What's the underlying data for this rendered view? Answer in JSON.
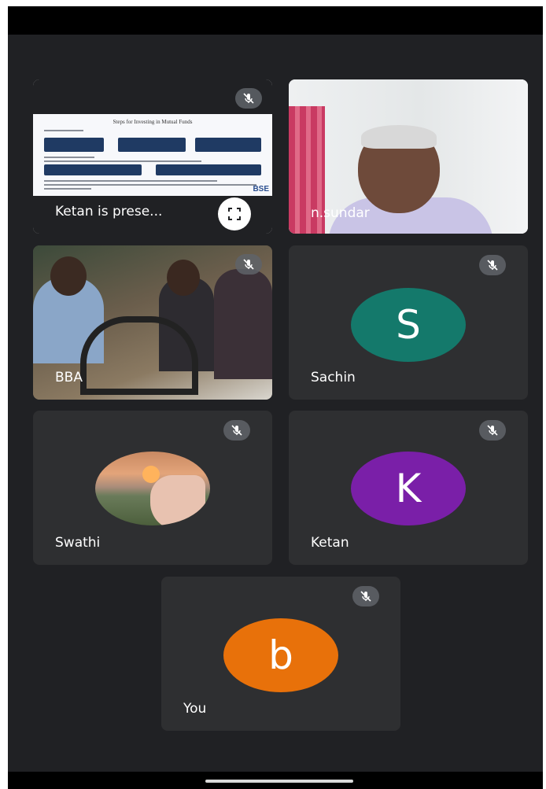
{
  "meeting": {
    "tiles": [
      {
        "name": "Ketan is prese...",
        "muted": true
      },
      {
        "name": "n.sundar",
        "muted": true
      },
      {
        "name": "BBA",
        "muted": true
      },
      {
        "name": "Sachin",
        "avatar_letter": "S",
        "avatar_color": "#14796b",
        "muted": true
      },
      {
        "name": "Swathi",
        "muted": true
      },
      {
        "name": "Ketan",
        "avatar_letter": "K",
        "avatar_color": "#7a1fa8",
        "muted": true
      },
      {
        "name": "You",
        "avatar_letter": "b",
        "avatar_color": "#e8710a",
        "muted": true
      }
    ],
    "slide_title": "Steps for Investing in Mutual Funds",
    "slide_logo": "BSE"
  },
  "icons": {
    "mic_off": "mic-off-icon",
    "fullscreen": "fullscreen-icon"
  },
  "colors": {
    "background": "#202124",
    "tile": "#2e2f31"
  }
}
